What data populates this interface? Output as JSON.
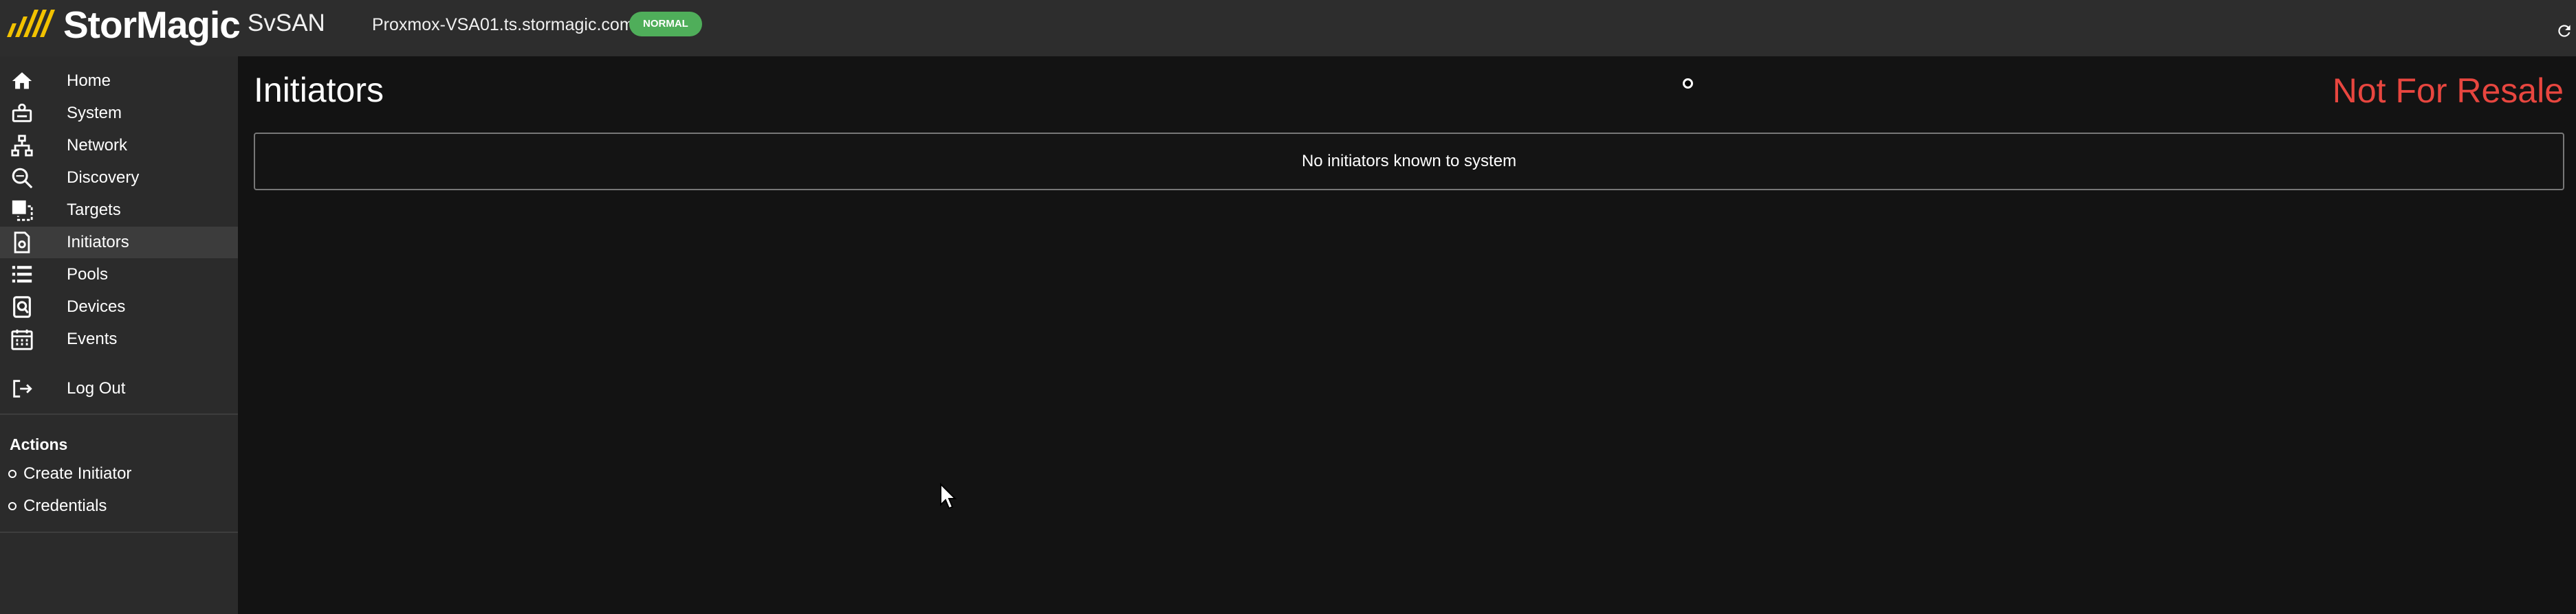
{
  "header": {
    "brand": "StorMagic",
    "product": "SvSAN",
    "hostname": "Proxmox-VSA01.ts.stormagic.com",
    "status": "NORMAL"
  },
  "sidebar": {
    "items": [
      {
        "label": "Home",
        "icon": "home-icon"
      },
      {
        "label": "System",
        "icon": "system-icon"
      },
      {
        "label": "Network",
        "icon": "network-icon"
      },
      {
        "label": "Discovery",
        "icon": "discovery-icon"
      },
      {
        "label": "Targets",
        "icon": "targets-icon"
      },
      {
        "label": "Initiators",
        "icon": "initiators-icon",
        "active": true
      },
      {
        "label": "Pools",
        "icon": "pools-icon"
      },
      {
        "label": "Devices",
        "icon": "devices-icon"
      },
      {
        "label": "Events",
        "icon": "events-icon"
      },
      {
        "label": "Log Out",
        "icon": "logout-icon"
      }
    ],
    "actions_title": "Actions",
    "actions": [
      {
        "label": "Create Initiator"
      },
      {
        "label": "Credentials"
      }
    ]
  },
  "main": {
    "title": "Initiators",
    "license_notice": "Not For Resale",
    "empty_message": "No initiators known to system"
  },
  "colors": {
    "topbar": "#2d2d2d",
    "sidebar": "#2b2b2b",
    "background": "#131313",
    "status_green": "#4fae5a",
    "notice_red": "#e8463f",
    "brand_yellow": "#f2c200"
  }
}
